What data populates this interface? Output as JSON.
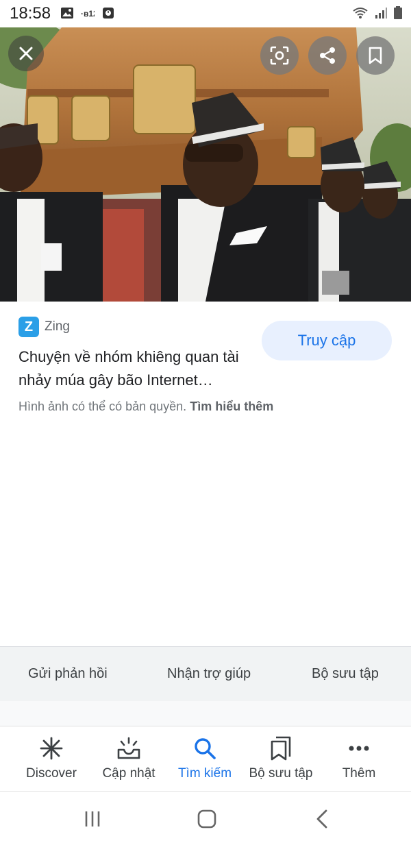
{
  "status_bar": {
    "time": "18:58",
    "left_icons": [
      "image-icon",
      "notification-icon",
      "screenshot-icon"
    ],
    "right_icons": [
      "wifi-icon",
      "signal-icon",
      "battery-icon"
    ]
  },
  "image_viewer": {
    "image_name": "pallbearers-carrying-coffin-image",
    "buttons": [
      "close-icon",
      "lens-icon",
      "share-icon",
      "bookmark-icon"
    ]
  },
  "result": {
    "source_logo": "Z",
    "source_name": "Zing",
    "title": "Chuyện về nhóm khiêng quan tài nhảy múa gây bão Internet…",
    "visit_label": "Truy cập",
    "copyright_text": "Hình ảnh có thể có bản quyền.",
    "learn_more": "Tìm hiểu thêm"
  },
  "footer_links": [
    "Gửi phản hồi",
    "Nhận trợ giúp",
    "Bộ sưu tập"
  ],
  "bottom_nav": {
    "items": [
      {
        "label": "Discover",
        "icon": "asterisk-icon"
      },
      {
        "label": "Cập nhật",
        "icon": "updates-icon"
      },
      {
        "label": "Tìm kiếm",
        "icon": "search-icon"
      },
      {
        "label": "Bộ sưu tập",
        "icon": "collections-icon"
      },
      {
        "label": "Thêm",
        "icon": "more-icon"
      }
    ],
    "active": "Tìm kiếm"
  },
  "colors": {
    "accent": "#1a73e8",
    "visit_button_bg": "#e8f0fe",
    "source_logo_bg": "#2b9fe7"
  }
}
